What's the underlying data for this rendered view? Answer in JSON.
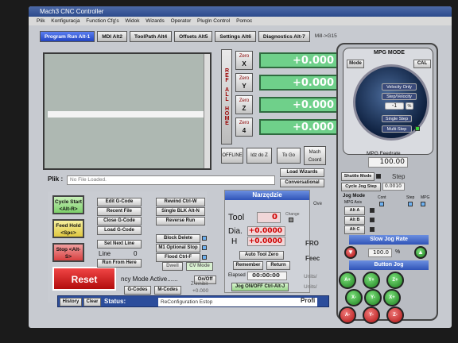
{
  "window": {
    "title": "Mach3 CNC Controller"
  },
  "menu": [
    "Plik",
    "Konfiguracja",
    "Function Cfg's",
    "Widok",
    "Wizards",
    "Operator",
    "PlugIn Control",
    "Pomoc"
  ],
  "tabs": [
    {
      "label": "Program Run Alt-1",
      "active": true
    },
    {
      "label": "MDI Alt2",
      "active": false
    },
    {
      "label": "ToolPath Alt4",
      "active": false
    },
    {
      "label": "Offsets Alt5",
      "active": false
    },
    {
      "label": "Settings Alt6",
      "active": false
    },
    {
      "label": "Diagnostics Alt-7",
      "active": false
    }
  ],
  "tab_extra": "Mill->G15",
  "ref_all_home": "REF ALL HOME",
  "axes": [
    {
      "zero_label": "Zero",
      "axis": "X",
      "value": "+0.000"
    },
    {
      "zero_label": "Zero",
      "axis": "Y",
      "value": "+0.000"
    },
    {
      "zero_label": "Zero",
      "axis": "Z",
      "value": "+0.000"
    },
    {
      "zero_label": "Zero",
      "axis": "4",
      "value": "+0.000"
    }
  ],
  "dro_buttons": {
    "offline": "OFFLINE",
    "goto_z": "Idz do Z",
    "to_go": "To Go",
    "mach_coords": "Mach Coord"
  },
  "file": {
    "label": "Plik :",
    "value": "No File Loaded."
  },
  "load_wizards": "Load Wizards",
  "conversational": "Conversational",
  "cycle": {
    "start": "Cycle Start <Alt-R>",
    "feedhold": "Feed Hold <Spc>",
    "stop": "Stop <Alt-S>",
    "reset": "Reset"
  },
  "gcode_buttons": [
    "Edit G-Code",
    "Recent File",
    "Close G-Code",
    "Load G-Code"
  ],
  "set_next_line": "Set Next Line",
  "line": {
    "label": "Line",
    "value": "0"
  },
  "run_from_here": "Run From Here",
  "rewind": "Rewind Ctrl-W",
  "single_blk": "Single BLK Alt-N",
  "reverse_run": "Reverse Run",
  "block_delete": "Block Delete",
  "m1_stop": "M1 Optional Stop",
  "flood": "Flood Ctrl-F",
  "dwell": "Dwell",
  "cv_mode": "CV Mode",
  "on_off": "On/Off",
  "z_inhibit": {
    "label": "Z Inhibit",
    "value": "+0.000"
  },
  "modal": "ncy Mode Active......",
  "g_codes": "G-Codes",
  "m_codes": "M-Codes",
  "history": "History",
  "clear": "Clear",
  "status": {
    "label": "Status:",
    "value": "ReConfiguration Estop"
  },
  "profile": "Profi",
  "tool": {
    "title": "Narzędzie",
    "tool_label": "Tool",
    "tool_value": "0",
    "change": "Change",
    "dia_label": "Dia.",
    "dia_value": "+0.0000",
    "h_label": "H",
    "h_value": "+0.0000",
    "auto_zero": "Auto Tool Zero",
    "remember": "Remember",
    "return": "Return",
    "elapsed_label": "Elapsed",
    "elapsed_value": "00:00:00",
    "jog_toggle": "Jog ON/OFF Ctrl-Alt-J"
  },
  "feed_fragments": {
    "fro": "FRO",
    "feed": "Feec",
    "units1": "Units/",
    "units2": "Units/",
    "ove": "Ove"
  },
  "mpg": {
    "title": "MPG MODE",
    "mode": "Mode",
    "cal": "CAL",
    "vel_only": "Velocity Only",
    "step_vel": "Step/Velocity",
    "step_val": "-1",
    "single_step": "Single Step",
    "multi_step": "Multi-Step",
    "feedrate_label": "MPG Feedrate",
    "feedrate_value": "100.00",
    "shuttle": "Shuttle Mode",
    "step": "Step",
    "cycle_jog": "Cycle Jog Step",
    "cycle_jog_value": "0.0010",
    "jog_mode": "Jog Mode",
    "cont": "Cont",
    "step2": "Step",
    "mpg2": "MPG",
    "mpg_axis": "MPG Axis",
    "alt_a": "Alt A",
    "alt_b": "Alt B",
    "alt_c": "Alt C",
    "slow_jog": "Slow Jog Rate",
    "slow_value": "100.0",
    "pct": "%",
    "button_jog": "Button Jog"
  },
  "jog_arrows": [
    "A+",
    "Y+",
    "Z+",
    "X-",
    "Y-",
    "X+",
    "A-",
    "Y-",
    "Z-"
  ],
  "colors": {
    "dro_green": "#6fd08a",
    "tab_blue": "#2244c0",
    "status_blue": "#2c4d9b",
    "reset_red": "#d01c1c"
  }
}
